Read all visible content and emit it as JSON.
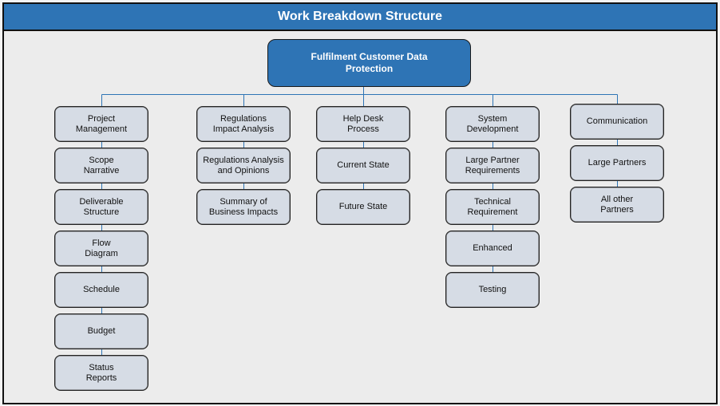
{
  "header": {
    "title": "Work Breakdown Structure"
  },
  "colors": {
    "accent": "#2e74b5",
    "node_fill": "#d6dce5",
    "connector": "#2e74b5",
    "background": "#ececec"
  },
  "root": {
    "label": "Fulfilment Customer Data\nProtection"
  },
  "branches": [
    {
      "label": "Project\nManagement",
      "children": [
        "Scope\nNarrative",
        "Deliverable\nStructure",
        "Flow\nDiagram",
        "Schedule",
        "Budget",
        "Status\nReports"
      ]
    },
    {
      "label": "Regulations\nImpact Analysis",
      "children": [
        "Regulations Analysis\nand Opinions",
        "Summary of\nBusiness Impacts"
      ]
    },
    {
      "label": "Help Desk\nProcess",
      "children": [
        "Current State",
        "Future State"
      ]
    },
    {
      "label": "System\nDevelopment",
      "children": [
        "Large Partner\nRequirements",
        "Technical\nRequirement",
        "Enhanced",
        "Testing"
      ]
    },
    {
      "label": "Communication",
      "children": [
        "Large Partners",
        "All other\nPartners"
      ]
    }
  ]
}
